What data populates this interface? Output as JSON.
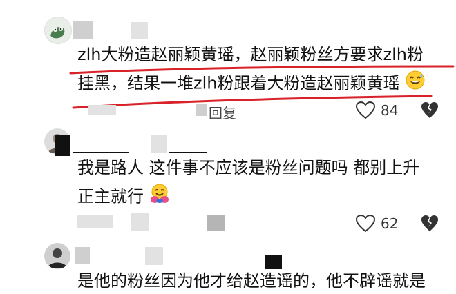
{
  "comments": [
    {
      "lines": [
        "zlh大粉造赵丽颖黄瑶，赵丽颖粉丝方要求zlh粉",
        "挂黑，结果一堆zlh粉跟着大粉造赵丽颖黄瑶"
      ],
      "reply_label": "回复",
      "likes": "84"
    },
    {
      "lines": [
        "我是路人  这件事不应该是粉丝问题吗  都别上升",
        "正主就行"
      ],
      "likes": "62"
    },
    {
      "lines": [
        "是他的粉丝因为他才给赵造谣的，他不辟谣就是"
      ]
    }
  ],
  "icons": {
    "heart": "heart-outline-icon",
    "dislike": "broken-heart-icon",
    "emoji_1": "grinning-sweat-emoji",
    "emoji_2": "hugging-emoji"
  },
  "colors": {
    "underline": "#d8232a",
    "text": "#111111"
  }
}
